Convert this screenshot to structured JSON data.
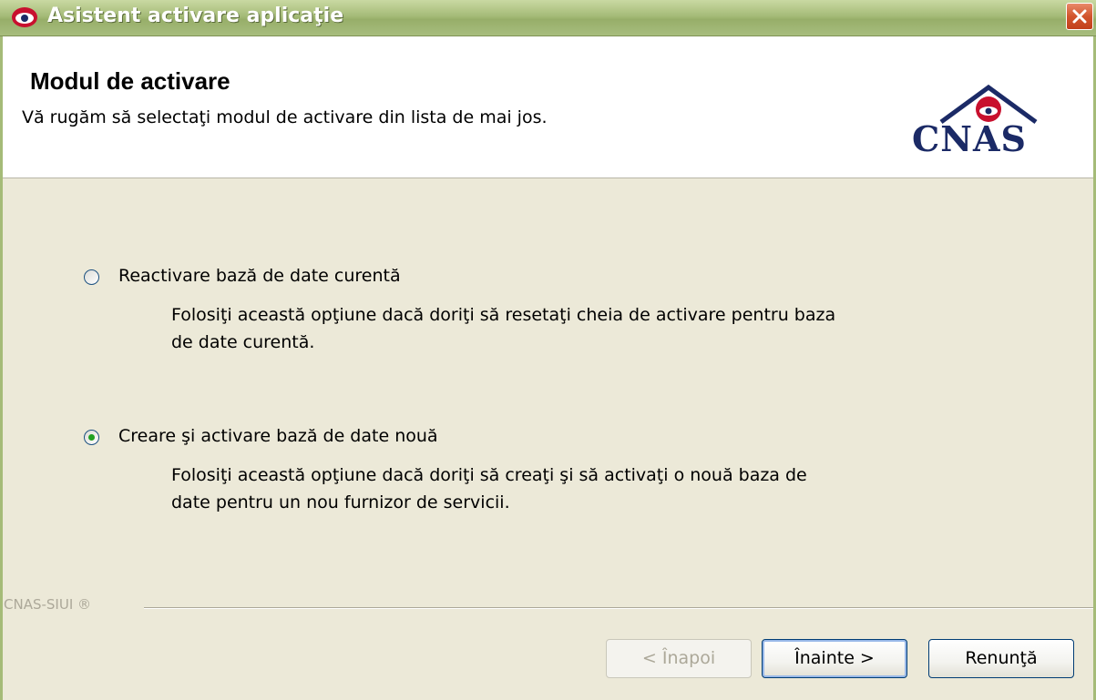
{
  "window": {
    "title": "Asistent activare aplicaţie",
    "close_icon": "close-icon"
  },
  "header": {
    "title": "Modul de activare",
    "subtitle": "Vă rugăm să selectaţi modul de activare din lista de mai jos.",
    "logo_text": "CNAS"
  },
  "options": [
    {
      "label": "Reactivare bază de date curentă",
      "description_line1": "Folosiţi această opţiune dacă doriţi să resetaţi cheia de activare pentru baza",
      "description_line2": "de date curentă.",
      "selected": false
    },
    {
      "label": "Creare şi activare bază de date nouă",
      "description_line1": "Folosiţi această opţiune dacă doriţi să creaţi şi să activaţi o nouă baza de",
      "description_line2": "date pentru un nou furnizor de servicii.",
      "selected": true
    }
  ],
  "footer": {
    "label": "CNAS-SIUI ®"
  },
  "buttons": {
    "back": "< Înapoi",
    "next": "Înainte >",
    "cancel": "Renunţă"
  },
  "colors": {
    "titlebar": "#a5bb78",
    "accent_green": "#21a121",
    "logo_blue": "#1b2a66",
    "logo_red": "#c8102e"
  }
}
